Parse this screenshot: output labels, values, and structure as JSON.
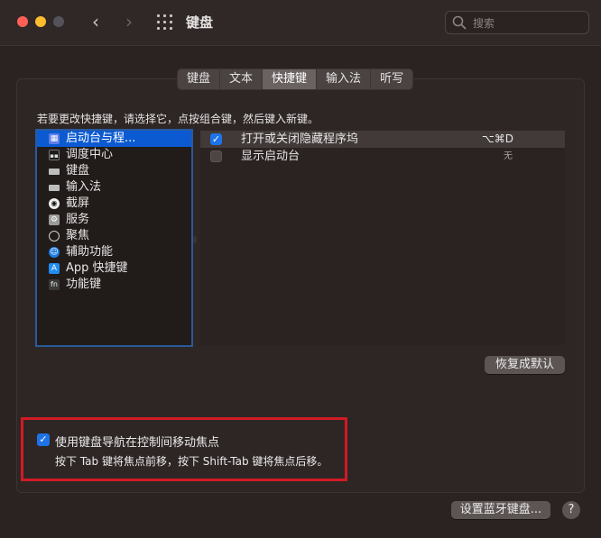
{
  "window": {
    "title": "键盘"
  },
  "toolbar": {
    "back_glyph": "‹",
    "forward_glyph": "›",
    "grid_icon": "grid-icon"
  },
  "search": {
    "placeholder": "搜索",
    "icon": "search-icon"
  },
  "tabs": [
    {
      "label": "键盘",
      "active": false
    },
    {
      "label": "文本",
      "active": false
    },
    {
      "label": "快捷键",
      "active": true
    },
    {
      "label": "输入法",
      "active": false
    },
    {
      "label": "听写",
      "active": false
    }
  ],
  "instruction": "若要更改快捷键，请选择它，点按组合键，然后键入新键。",
  "categories": [
    {
      "label": "启动台与程...",
      "icon": "launchpad-icon",
      "glyph": "▦",
      "selected": true
    },
    {
      "label": "调度中心",
      "icon": "mission-control-icon",
      "glyph": "▪▪"
    },
    {
      "label": "键盘",
      "icon": "keyboard-icon",
      "glyph": ""
    },
    {
      "label": "输入法",
      "icon": "keyboard-icon",
      "glyph": ""
    },
    {
      "label": "截屏",
      "icon": "screenshot-icon",
      "glyph": "◉"
    },
    {
      "label": "服务",
      "icon": "gear-icon",
      "glyph": "⚙"
    },
    {
      "label": "聚焦",
      "icon": "spotlight-icon",
      "glyph": ""
    },
    {
      "label": "辅助功能",
      "icon": "accessibility-icon",
      "glyph": "☺"
    },
    {
      "label": "App 快捷键",
      "icon": "app-store-icon",
      "glyph": "A"
    },
    {
      "label": "功能键",
      "icon": "fn-icon",
      "glyph": "fn"
    }
  ],
  "shortcuts": [
    {
      "checked": true,
      "label": "打开或关闭隐藏程序坞",
      "key": "⌥⌘D"
    },
    {
      "checked": false,
      "label": "显示启动台",
      "key": "无"
    }
  ],
  "buttons": {
    "restore_defaults": "恢复成默认",
    "bluetooth_keyboard": "设置蓝牙键盘...",
    "help": "?"
  },
  "keyboard_navigation": {
    "checked": true,
    "label": "使用键盘导航在控制间移动焦点",
    "hint": "按下 Tab 键将焦点前移，按下 Shift-Tab 键将焦点后移。"
  },
  "colors": {
    "accent": "#1e73e8",
    "highlight_box": "#d11a24",
    "selection": "#0b5ad1"
  }
}
